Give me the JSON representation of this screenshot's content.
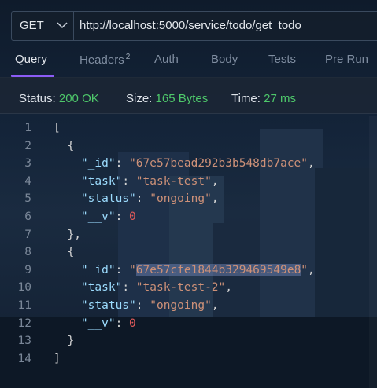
{
  "request": {
    "method": "GET",
    "url": "http://localhost:5000/service/todo/get_todo"
  },
  "tabs": [
    {
      "label": "Query",
      "active": true
    },
    {
      "label": "Headers",
      "badge": "2"
    },
    {
      "label": "Auth"
    },
    {
      "label": "Body"
    },
    {
      "label": "Tests"
    },
    {
      "label": "Pre Run"
    }
  ],
  "response": {
    "status_label": "Status:",
    "status_value": "200 OK",
    "size_label": "Size:",
    "size_value": "165 Bytes",
    "time_label": "Time:",
    "time_value": "27 ms"
  },
  "code": {
    "line_numbers": [
      "1",
      "2",
      "3",
      "4",
      "5",
      "6",
      "7",
      "8",
      "9",
      "10",
      "11",
      "12",
      "13",
      "14"
    ],
    "lines": [
      "[",
      "  {",
      "    \"_id\": \"67e57bead292b3b548db7ace\",",
      "    \"task\": \"task-test\",",
      "    \"status\": \"ongoing\",",
      "    \"__v\": 0",
      "  },",
      "  {",
      "    \"_id\": \"67e57cfe1844b329469549e8\",",
      "    \"task\": \"task-test-2\",",
      "    \"status\": \"ongoing\",",
      "    \"__v\": 0",
      "  }",
      "]"
    ]
  },
  "colors": {
    "accent": "#8b5cf6",
    "status_green": "#4ec86a",
    "json_key": "#9cdcfe",
    "json_string": "#ce9178",
    "json_number": "#e05a5a"
  }
}
